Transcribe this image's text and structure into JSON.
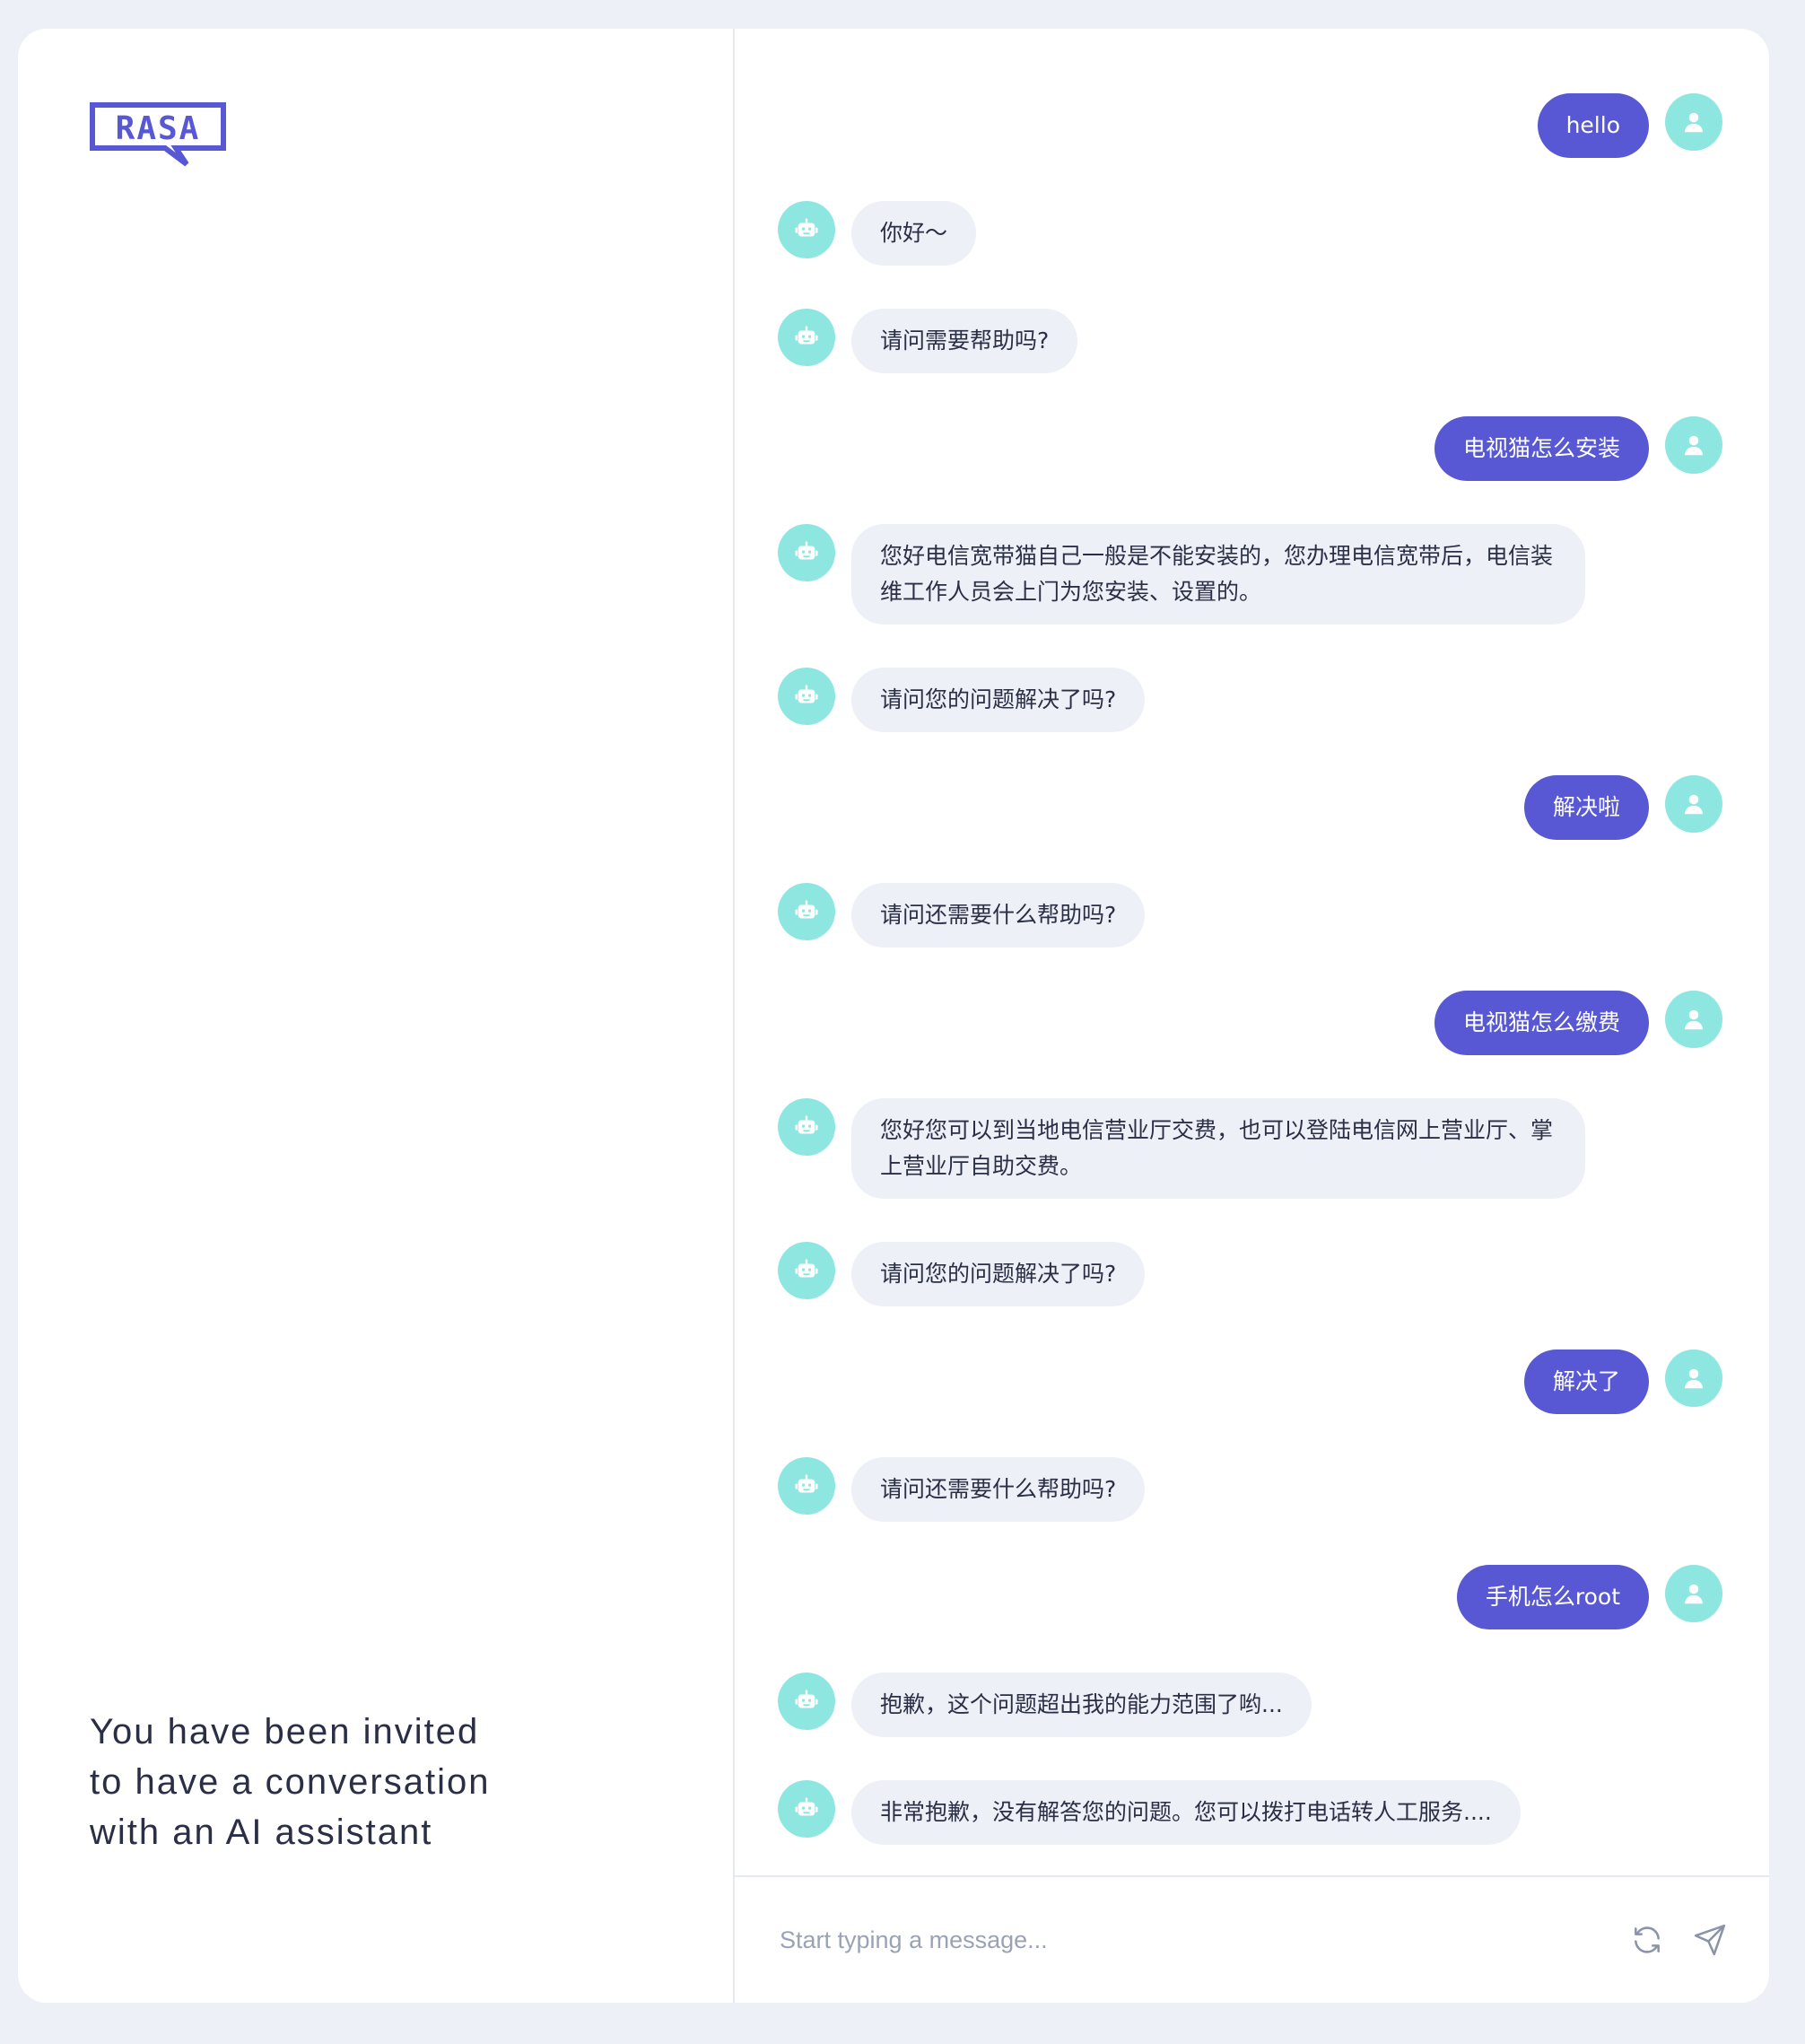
{
  "brand": {
    "logo_text": "RASA",
    "accent_color": "#5858d4",
    "avatar_color": "#8ee6e0"
  },
  "left_panel": {
    "invite_text": "You have been invited\nto have a conversation\nwith an AI assistant"
  },
  "messages": [
    {
      "sender": "user",
      "text": "hello",
      "avatar_icon": "user-icon"
    },
    {
      "sender": "bot",
      "text": "你好～",
      "avatar_icon": "robot-icon"
    },
    {
      "sender": "bot",
      "text": "请问需要帮助吗?",
      "avatar_icon": "robot-icon"
    },
    {
      "sender": "user",
      "text": "电视猫怎么安装",
      "avatar_icon": "user-icon"
    },
    {
      "sender": "bot",
      "text": "您好电信宽带猫自己一般是不能安装的，您办理电信宽带后，电信装维工作人员会上门为您安装、设置的。",
      "avatar_icon": "robot-icon"
    },
    {
      "sender": "bot",
      "text": "请问您的问题解决了吗?",
      "avatar_icon": "robot-icon"
    },
    {
      "sender": "user",
      "text": "解决啦",
      "avatar_icon": "user-icon"
    },
    {
      "sender": "bot",
      "text": "请问还需要什么帮助吗?",
      "avatar_icon": "robot-icon"
    },
    {
      "sender": "user",
      "text": "电视猫怎么缴费",
      "avatar_icon": "user-icon"
    },
    {
      "sender": "bot",
      "text": "您好您可以到当地电信营业厅交费，也可以登陆电信网上营业厅、掌上营业厅自助交费。",
      "avatar_icon": "robot-icon"
    },
    {
      "sender": "bot",
      "text": "请问您的问题解决了吗?",
      "avatar_icon": "robot-icon"
    },
    {
      "sender": "user",
      "text": "解决了",
      "avatar_icon": "user-icon"
    },
    {
      "sender": "bot",
      "text": "请问还需要什么帮助吗?",
      "avatar_icon": "robot-icon"
    },
    {
      "sender": "user",
      "text": "手机怎么root",
      "avatar_icon": "user-icon"
    },
    {
      "sender": "bot",
      "text": "抱歉，这个问题超出我的能力范围了哟...",
      "avatar_icon": "robot-icon"
    },
    {
      "sender": "bot",
      "text": "非常抱歉，没有解答您的问题。您可以拨打电话转人工服务....",
      "avatar_icon": "robot-icon"
    }
  ],
  "composer": {
    "placeholder": "Start typing a message...",
    "value": "",
    "restart_icon": "refresh-icon",
    "send_icon": "send-icon"
  }
}
